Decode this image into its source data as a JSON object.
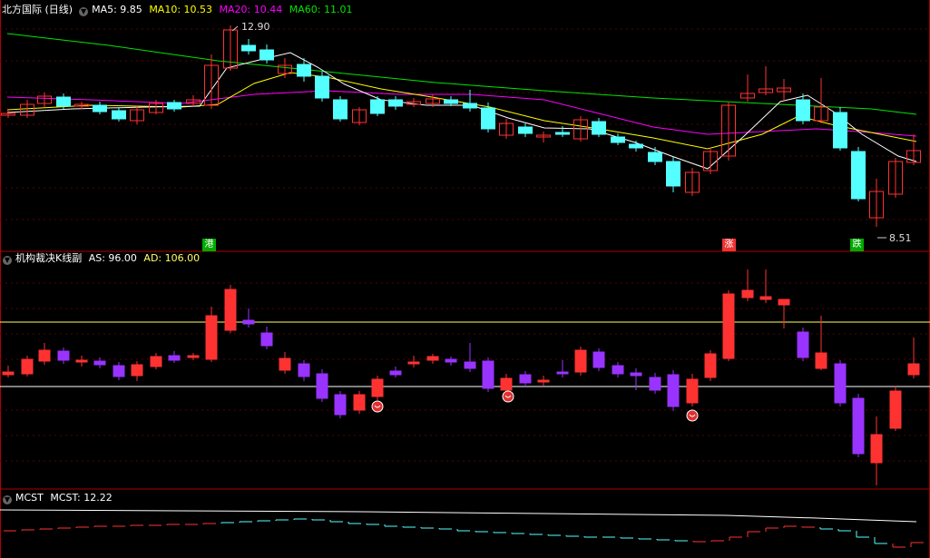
{
  "panel1": {
    "title": "北方国际 (日线)",
    "ma5_label": "MA5: 9.85",
    "ma10_label": "MA10: 10.53",
    "ma20_label": "MA20: 10.44",
    "ma60_label": "MA60: 11.01",
    "high_label": "12.90",
    "low_label": "8.51",
    "tags": [
      "港",
      "涨",
      "跌"
    ],
    "colors": {
      "up": "#ff3232",
      "down": "#54ffff",
      "ma5": "#ffffff",
      "ma10": "#ffff00",
      "ma20": "#ff00ff",
      "ma60": "#00e600",
      "tag_green": "#00aa00",
      "tag_red": "#ee3333"
    }
  },
  "panel2": {
    "title": "机构裁决K线副",
    "as_label": "AS: 96.00",
    "ad_label": "AD: 106.00",
    "icons": [
      "signal-ball-icon",
      "signal-ball-icon",
      "signal-ball-icon"
    ],
    "colors": {
      "up": "#ff3232",
      "down": "#9933ff",
      "line_as": "#ffffff",
      "line_ad": "#ffff66"
    }
  },
  "panel3": {
    "title": "MCST",
    "mcst_label": "MCST: 12.22",
    "colors": {
      "line": "#ffffff",
      "up": "#ff3232",
      "down": "#54ffff"
    }
  }
}
